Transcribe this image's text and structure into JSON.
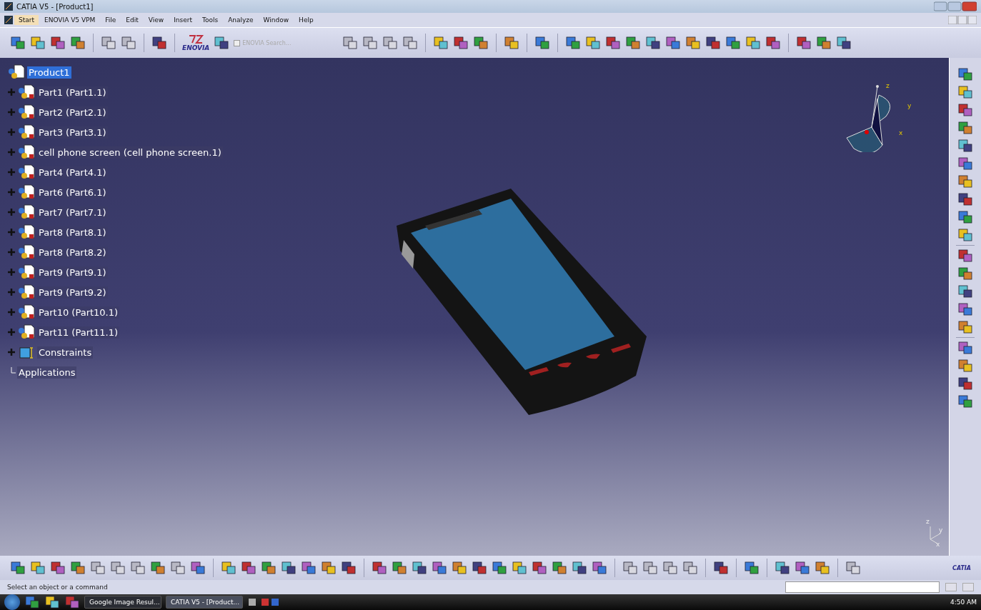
{
  "window": {
    "title": "CATIA V5 - [Product1]"
  },
  "menu": [
    {
      "label": "Start",
      "selected": true
    },
    {
      "label": "ENOVIA V5 VPM",
      "selected": false
    },
    {
      "label": "File",
      "selected": false
    },
    {
      "label": "Edit",
      "selected": false
    },
    {
      "label": "View",
      "selected": false
    },
    {
      "label": "Insert",
      "selected": false
    },
    {
      "label": "Tools",
      "selected": false
    },
    {
      "label": "Analyze",
      "selected": false
    },
    {
      "label": "Window",
      "selected": false
    },
    {
      "label": "Help",
      "selected": false
    }
  ],
  "toolbar": {
    "logo_text": "ENOVIA",
    "search": {
      "label": "ENOVIA Search...",
      "checked": false,
      "disabled": true
    }
  },
  "tree": {
    "label": "Product1",
    "selected": true,
    "children": [
      {
        "label": "Part1 (Part1.1)",
        "kind": "part",
        "expandable": true
      },
      {
        "label": "Part2 (Part2.1)",
        "kind": "part",
        "expandable": true
      },
      {
        "label": "Part3 (Part3.1)",
        "kind": "part",
        "expandable": true
      },
      {
        "label": "cell phone screen (cell phone screen.1)",
        "kind": "part",
        "expandable": true
      },
      {
        "label": "Part4 (Part4.1)",
        "kind": "part",
        "expandable": true
      },
      {
        "label": "Part6 (Part6.1)",
        "kind": "part",
        "expandable": true
      },
      {
        "label": "Part7 (Part7.1)",
        "kind": "part",
        "expandable": true
      },
      {
        "label": "Part8 (Part8.1)",
        "kind": "part",
        "expandable": true
      },
      {
        "label": "Part8 (Part8.2)",
        "kind": "part",
        "expandable": true
      },
      {
        "label": "Part9 (Part9.1)",
        "kind": "part",
        "expandable": true
      },
      {
        "label": "Part9 (Part9.2)",
        "kind": "part",
        "expandable": true
      },
      {
        "label": "Part10 (Part10.1)",
        "kind": "part",
        "expandable": true
      },
      {
        "label": "Part11 (Part11.1)",
        "kind": "part",
        "expandable": true
      },
      {
        "label": "Constraints",
        "kind": "constraints",
        "expandable": true
      },
      {
        "label": "Applications",
        "kind": "applications",
        "expandable": false
      }
    ]
  },
  "compass": {
    "axes": [
      "z",
      "y",
      "x"
    ]
  },
  "corner_axes": [
    "z",
    "y",
    "x"
  ],
  "bottom_logo": "CATIA",
  "status_bar": {
    "message": "Select an object or a command"
  },
  "taskbar": {
    "buttons": [
      {
        "label": "Google Image Resul...",
        "selected": false
      },
      {
        "label": "CATIA V5 - [Product...",
        "selected": true
      }
    ],
    "clock": "4:50 AM"
  }
}
